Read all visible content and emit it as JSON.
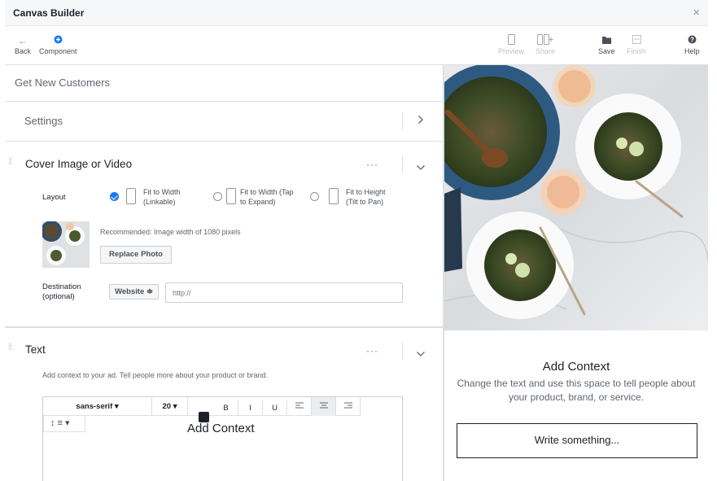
{
  "window": {
    "title": "Canvas Builder",
    "close_glyph": "×"
  },
  "toolbar": {
    "back_label": "Back",
    "component_label": "Component",
    "preview_label": "Preview",
    "share_label": "Share",
    "save_label": "Save",
    "finish_label": "Finish",
    "help_label": "Help"
  },
  "campaign": {
    "name": "Get New Customers"
  },
  "settings": {
    "label": "Settings"
  },
  "cover": {
    "title": "Cover Image or Video",
    "more": "···",
    "layout_label": "Layout",
    "options": [
      {
        "line1": "Fit to Width",
        "line2": "(Linkable)",
        "selected": true
      },
      {
        "line1": "Fit to Width (Tap",
        "line2": "to Expand)",
        "selected": false
      },
      {
        "line1": "Fit to Height",
        "line2": "(Tilt to Pan)",
        "selected": false
      }
    ],
    "recommendation": "Recommended: Image width of 1080 pixels",
    "replace_label": "Replace Photo",
    "destination_line1": "Destination",
    "destination_line2": "(optional)",
    "destination_type": "Website ≑",
    "url_placeholder": "http://"
  },
  "text_section": {
    "title": "Text",
    "more": "···",
    "help": "Add context to your ad. Tell people more about your product or brand.",
    "font": "sans-serif ▾",
    "size": "20 ▾",
    "bold": "B",
    "italic": "I",
    "underline": "U",
    "line_height": "↕ ≡ ▾",
    "content": "Add Context",
    "alignment": "center"
  },
  "preview": {
    "heading": "Add Context",
    "description": "Change the text and use this space to tell people about your product, brand, or service.",
    "button_label": "Write something..."
  },
  "colors": {
    "accent": "#1877f2",
    "text": "#1d2129",
    "muted": "#606770",
    "border": "#dddfe2"
  }
}
